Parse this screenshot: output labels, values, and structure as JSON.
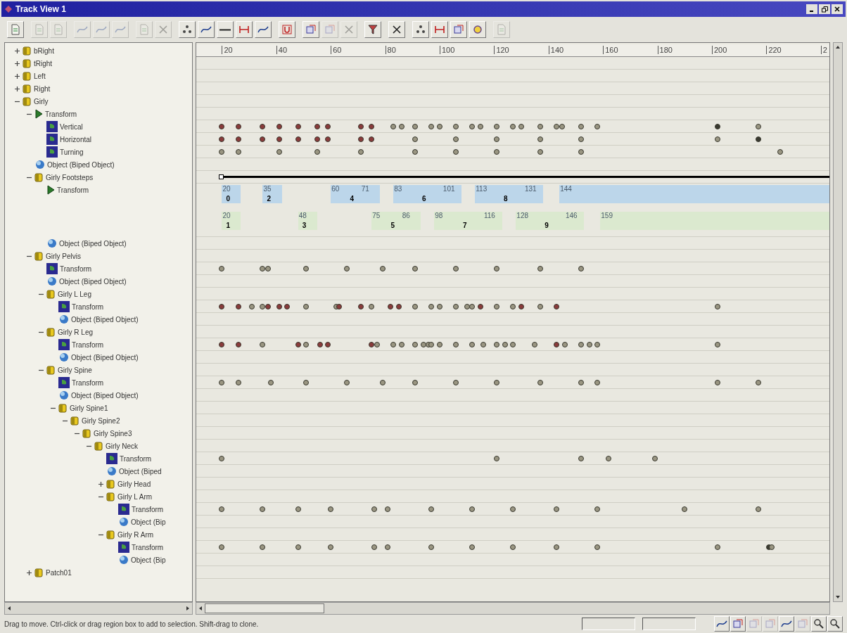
{
  "window": {
    "title": "Track View 1"
  },
  "toolbar": [
    [
      {
        "kind": "page",
        "disabled": false
      }
    ],
    [
      {
        "kind": "page",
        "disabled": true
      },
      {
        "kind": "page",
        "disabled": true
      }
    ],
    [
      {
        "kind": "curve",
        "disabled": true
      },
      {
        "kind": "curve",
        "disabled": true
      },
      {
        "kind": "curve",
        "disabled": true
      }
    ],
    [
      {
        "kind": "page",
        "disabled": true
      },
      {
        "kind": "cross",
        "disabled": true
      }
    ],
    [
      {
        "kind": "dots",
        "disabled": false
      },
      {
        "kind": "curve",
        "disabled": false
      },
      {
        "kind": "line",
        "disabled": false
      },
      {
        "kind": "range",
        "disabled": false
      },
      {
        "kind": "curve",
        "disabled": false
      }
    ],
    [
      {
        "kind": "magnet",
        "disabled": false
      }
    ],
    [
      {
        "kind": "box",
        "disabled": false
      },
      {
        "kind": "box",
        "disabled": true
      },
      {
        "kind": "cross",
        "disabled": true
      }
    ],
    [
      {
        "kind": "funnel",
        "disabled": false
      }
    ],
    [
      {
        "kind": "cross",
        "disabled": false
      }
    ],
    [
      {
        "kind": "dots",
        "disabled": false
      },
      {
        "kind": "range",
        "disabled": false
      },
      {
        "kind": "box",
        "disabled": false
      },
      {
        "kind": "circle",
        "disabled": false
      }
    ],
    [
      {
        "kind": "page",
        "disabled": true
      }
    ]
  ],
  "ruler": [
    "20",
    "40",
    "60",
    "80",
    "100",
    "120",
    "140",
    "160",
    "180",
    "200",
    "220",
    "2"
  ],
  "tree": [
    {
      "label": "bRight",
      "kind": "node",
      "expanded": false
    },
    {
      "label": "tRight",
      "kind": "node",
      "expanded": false
    },
    {
      "label": "Left",
      "kind": "node",
      "expanded": false
    },
    {
      "label": "Right",
      "kind": "node",
      "expanded": false
    },
    {
      "label": "Girly",
      "kind": "node",
      "expanded": true,
      "children": [
        {
          "label": "Transform",
          "kind": "transform",
          "expanded": true,
          "children": [
            {
              "label": "Vertical",
              "kind": "track"
            },
            {
              "label": "Horizontal",
              "kind": "track"
            },
            {
              "label": "Turning",
              "kind": "track"
            }
          ]
        },
        {
          "label": "Object (Biped Object)",
          "kind": "object"
        },
        {
          "label": "Girly Footsteps",
          "kind": "node",
          "expanded": true,
          "children": [
            {
              "label": "Transform",
              "kind": "footsteps",
              "footsteps": {
                "left": [
                  {
                    "texts": [
                      "20"
                    ],
                    "number": "0"
                  },
                  {
                    "texts": [
                      "35"
                    ],
                    "number": "2"
                  },
                  {
                    "texts": [
                      "60",
                      "71"
                    ],
                    "number": "4"
                  },
                  {
                    "texts": [
                      "83",
                      "101"
                    ],
                    "number": "6"
                  },
                  {
                    "texts": [
                      "113",
                      "131"
                    ],
                    "number": "8"
                  },
                  {
                    "texts": [
                      "144"
                    ],
                    "open": true
                  }
                ],
                "right": [
                  {
                    "texts": [
                      "20"
                    ],
                    "number": "1"
                  },
                  {
                    "texts": [
                      "48"
                    ],
                    "number": "3"
                  },
                  {
                    "texts": [
                      "75",
                      "86"
                    ],
                    "number": "5"
                  },
                  {
                    "texts": [
                      "98",
                      "116"
                    ],
                    "number": "7"
                  },
                  {
                    "texts": [
                      "128",
                      "146"
                    ],
                    "number": "9"
                  },
                  {
                    "texts": [
                      "159"
                    ],
                    "open": true
                  }
                ]
              }
            },
            {
              "label": "Object (Biped Object)",
              "kind": "object"
            }
          ]
        },
        {
          "label": "Girly Pelvis",
          "kind": "node",
          "expanded": true,
          "children": [
            {
              "label": "Transform",
              "kind": "track"
            },
            {
              "label": "Object (Biped Object)",
              "kind": "object"
            },
            {
              "label": "Girly L Leg",
              "kind": "node",
              "expanded": true,
              "children": [
                {
                  "label": "Transform",
                  "kind": "track"
                },
                {
                  "label": "Object (Biped Object)",
                  "kind": "object"
                }
              ]
            },
            {
              "label": "Girly R Leg",
              "kind": "node",
              "expanded": true,
              "children": [
                {
                  "label": "Transform",
                  "kind": "track"
                },
                {
                  "label": "Object (Biped Object)",
                  "kind": "object"
                }
              ]
            },
            {
              "label": "Girly Spine",
              "kind": "node",
              "expanded": true,
              "children": [
                {
                  "label": "Transform",
                  "kind": "track"
                },
                {
                  "label": "Object (Biped Object)",
                  "kind": "object"
                },
                {
                  "label": "Girly Spine1",
                  "kind": "node",
                  "expanded": true,
                  "children": [
                    {
                      "label": "Girly Spine2",
                      "kind": "node",
                      "expanded": true,
                      "children": [
                        {
                          "label": "Girly Spine3",
                          "kind": "node",
                          "expanded": true,
                          "children": [
                            {
                              "label": "Girly Neck",
                              "kind": "node",
                              "expanded": true,
                              "children": [
                                {
                                  "label": "Transform",
                                  "kind": "track"
                                },
                                {
                                  "label": "Object (Biped",
                                  "kind": "object"
                                },
                                {
                                  "label": "Girly Head",
                                  "kind": "node",
                                  "expanded": false
                                },
                                {
                                  "label": "Girly L Arm",
                                  "kind": "node",
                                  "expanded": true,
                                  "children": [
                                    {
                                      "label": "Transform",
                                      "kind": "track"
                                    },
                                    {
                                      "label": "Object (Bip",
                                      "kind": "object"
                                    }
                                  ]
                                },
                                {
                                  "label": "Girly R Arm",
                                  "kind": "node",
                                  "expanded": true,
                                  "children": [
                                    {
                                      "label": "Transform",
                                      "kind": "track"
                                    },
                                    {
                                      "label": "Object (Bip",
                                      "kind": "object"
                                    }
                                  ]
                                }
                              ]
                            }
                          ]
                        }
                      ]
                    }
                  ]
                }
              ]
            }
          ]
        },
        {
          "label": "Patch01",
          "kind": "node",
          "expanded": false
        }
      ]
    }
  ],
  "status_bar": {
    "message": "Drag to move. Ctrl-click or drag region box to add to selection. Shift-drag to clone.",
    "tools": [
      {
        "kind": "curve",
        "disabled": false
      },
      {
        "kind": "box",
        "disabled": false
      },
      {
        "kind": "box",
        "disabled": true
      },
      {
        "kind": "box",
        "disabled": true
      },
      {
        "kind": "curve",
        "disabled": false
      },
      {
        "kind": "box",
        "disabled": true
      },
      {
        "kind": "search",
        "disabled": false
      },
      {
        "kind": "search",
        "disabled": false
      }
    ]
  }
}
